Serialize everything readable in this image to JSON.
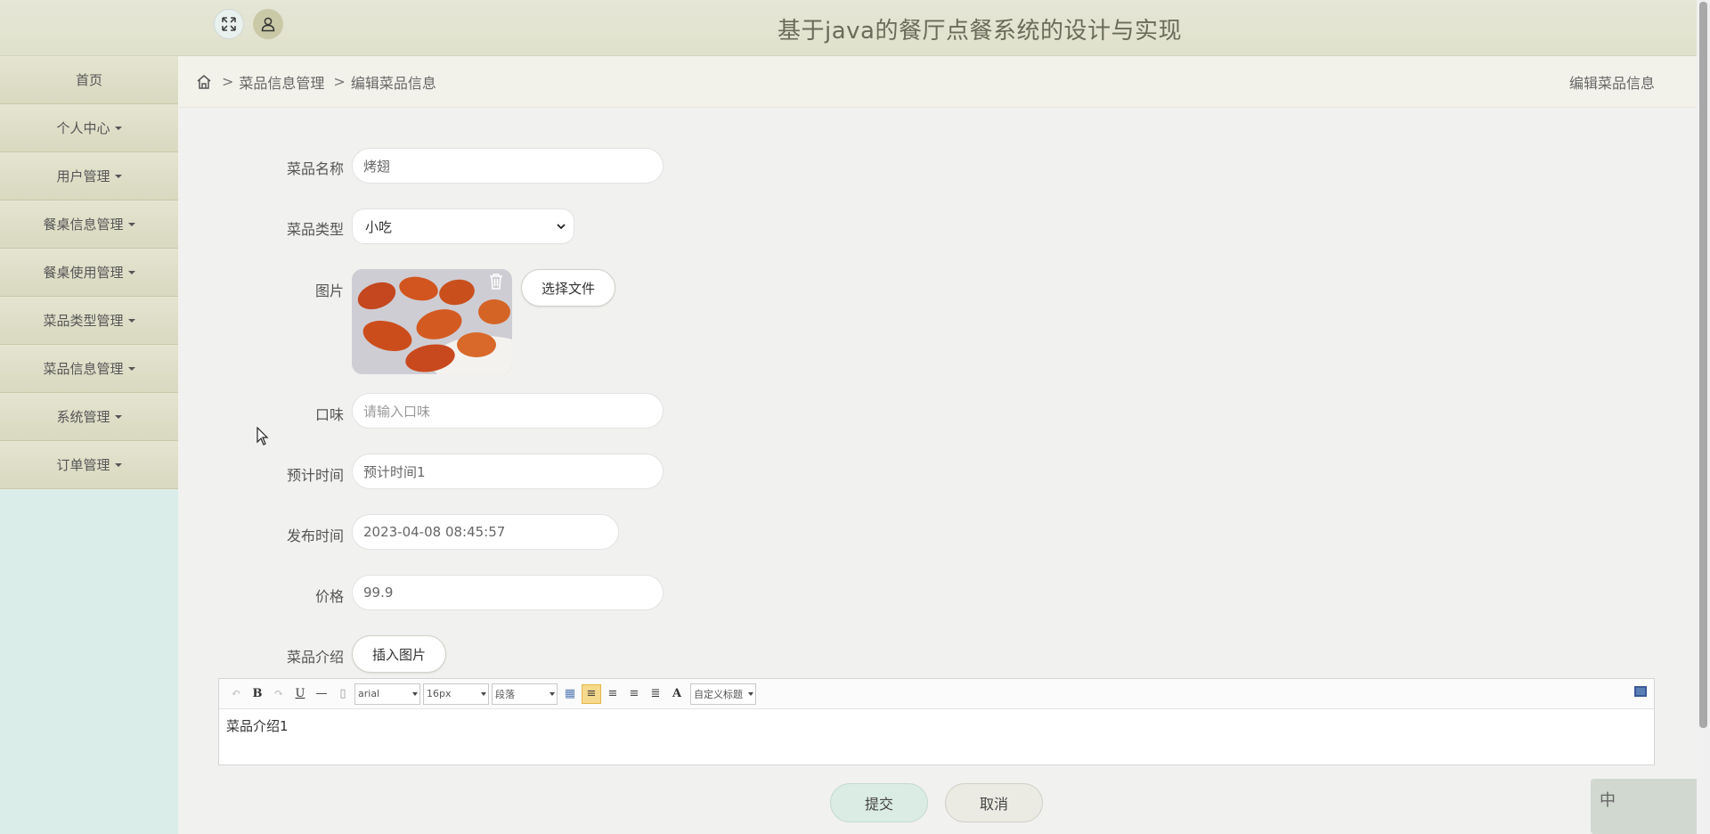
{
  "header": {
    "title": "基于java的餐厅点餐系统的设计与实现",
    "icons": [
      "expand-icon",
      "user-icon"
    ]
  },
  "sidebar": {
    "items": [
      {
        "label": "首页",
        "has_caret": false
      },
      {
        "label": "个人中心",
        "has_caret": true
      },
      {
        "label": "用户管理",
        "has_caret": true
      },
      {
        "label": "餐桌信息管理",
        "has_caret": true
      },
      {
        "label": "餐桌使用管理",
        "has_caret": true
      },
      {
        "label": "菜品类型管理",
        "has_caret": true
      },
      {
        "label": "菜品信息管理",
        "has_caret": true
      },
      {
        "label": "系统管理",
        "has_caret": true
      },
      {
        "label": "订单管理",
        "has_caret": true
      }
    ]
  },
  "breadcrumb": {
    "sep": ">",
    "items": [
      "菜品信息管理",
      "编辑菜品信息"
    ],
    "right_title": "编辑菜品信息"
  },
  "form": {
    "name": {
      "label": "菜品名称",
      "value": "烤翅"
    },
    "type": {
      "label": "菜品类型",
      "value": "小吃"
    },
    "image": {
      "label": "图片",
      "choose_file": "选择文件"
    },
    "taste": {
      "label": "口味",
      "placeholder": "请输入口味"
    },
    "eta": {
      "label": "预计时间",
      "value": "预计时间1"
    },
    "publish_time": {
      "label": "发布时间",
      "value": "2023-04-08 08:45:57"
    },
    "price": {
      "label": "价格",
      "value": "99.9"
    },
    "intro": {
      "label": "菜品介绍",
      "insert_image": "插入图片"
    }
  },
  "editor": {
    "font_family": "arial",
    "font_size": "16px",
    "paragraph": "段落",
    "custom_title": "自定义标题",
    "content": "菜品介绍1"
  },
  "actions": {
    "submit": "提交",
    "cancel": "取消"
  },
  "ime": {
    "char": "中"
  },
  "colors": {
    "header_bg": "#e2e3cf",
    "sidebar_bg": "#dbede8",
    "menu_bg": "#dcdcc4",
    "submit_bg": "#dbece4",
    "cancel_bg": "#ebebe4"
  }
}
